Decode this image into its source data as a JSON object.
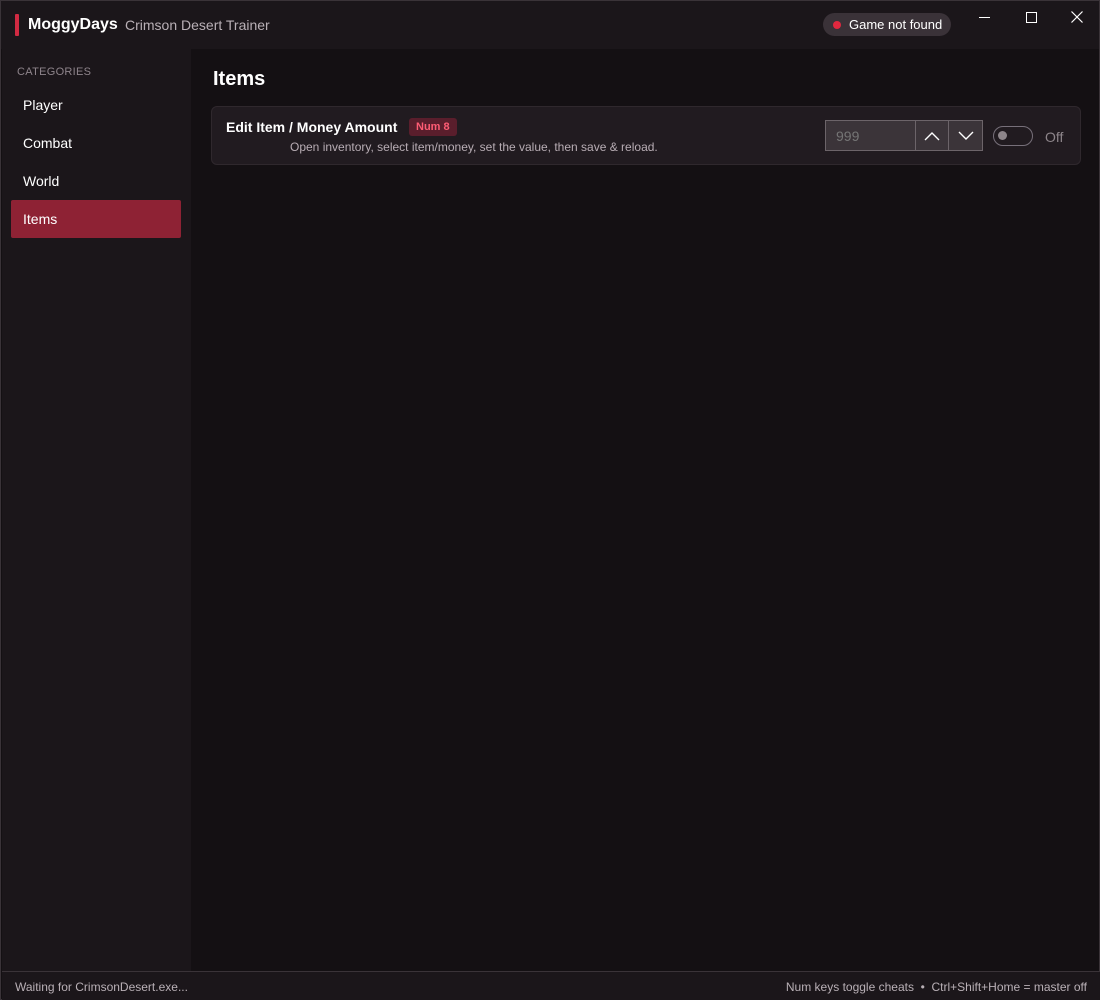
{
  "titlebar": {
    "brand": "MoggyDays",
    "subtitle": "Crimson Desert Trainer",
    "status_text": "Game not found"
  },
  "sidebar": {
    "section_label": "CATEGORIES",
    "items": [
      {
        "label": "Player"
      },
      {
        "label": "Combat"
      },
      {
        "label": "World"
      },
      {
        "label": "Items"
      }
    ],
    "active_item": "Items"
  },
  "main": {
    "title": "Items",
    "cheats": [
      {
        "name": "Edit Item / Money Amount",
        "hotkey": "Num 8",
        "description": "Open inventory, select item/money, set the value, then save & reload.",
        "input_placeholder": "999",
        "toggle_label": "Off",
        "enabled": false
      }
    ]
  },
  "footer": {
    "status": "Waiting for CrimsonDesert.exe...",
    "hint": "Num keys toggle cheats  •  Ctrl+Shift+Home = master off"
  },
  "colors": {
    "accent": "#d12a42",
    "active_nav": "#8e2234",
    "status_dot": "#e0283f",
    "background": "#141013"
  }
}
